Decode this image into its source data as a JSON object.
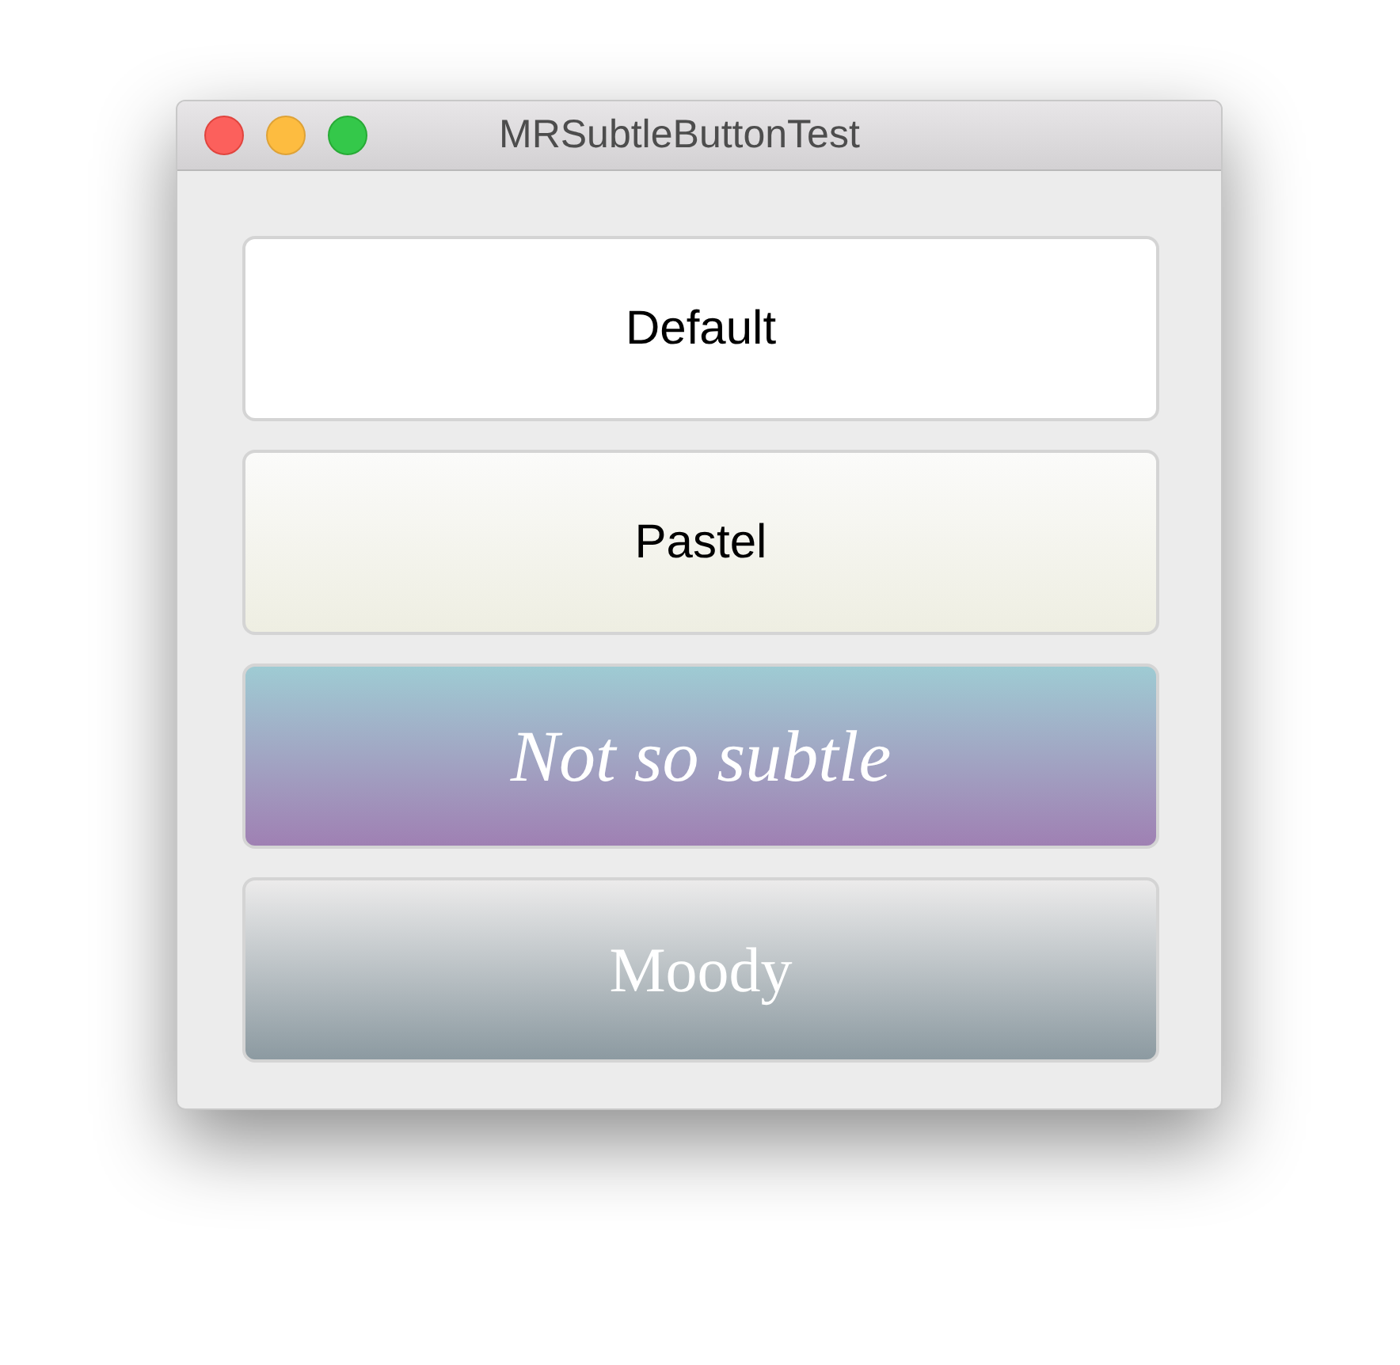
{
  "window": {
    "title": "MRSubtleButtonTest"
  },
  "buttons": [
    {
      "label": "Default",
      "kind": "default"
    },
    {
      "label": "Pastel",
      "kind": "pastel"
    },
    {
      "label": "Not so subtle",
      "kind": "bold"
    },
    {
      "label": "Moody",
      "kind": "moody"
    }
  ]
}
